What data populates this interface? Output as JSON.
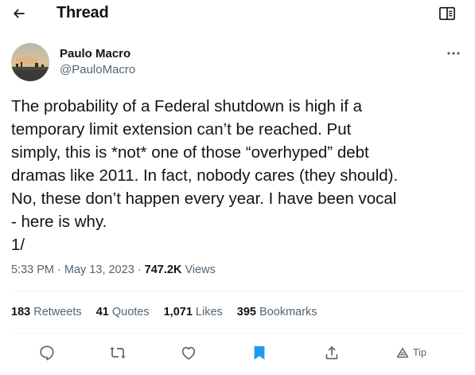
{
  "header": {
    "title": "Thread",
    "back_icon": "arrow-left-icon",
    "reader_icon": "open-book-icon"
  },
  "author": {
    "name": "Paulo Macro",
    "handle": "@PauloMacro",
    "avatar": "sunset-cityscape-photo"
  },
  "tweet": {
    "lines": [
      "The probability of a Federal shutdown is high if a",
      "temporary limit extension can’t be reached. Put",
      "simply, this is *not* one of those “overhyped” debt",
      "dramas like 2011. In fact, nobody cares (they should).",
      "No, these don’t happen every year. I have been vocal",
      "- here is why.",
      "1/"
    ]
  },
  "meta": {
    "time": "5:33 PM",
    "separator": " · ",
    "date": "May 13, 2023",
    "views_count": "747.2K",
    "views_label": " Views"
  },
  "stats": {
    "retweets": {
      "count": "183",
      "label": " Retweets"
    },
    "quotes": {
      "count": "41",
      "label": " Quotes"
    },
    "likes": {
      "count": "1,071",
      "label": " Likes"
    },
    "bookmarks": {
      "count": "395",
      "label": " Bookmarks"
    }
  },
  "actions": {
    "reply_icon": "speech-bubble-icon",
    "retweet_icon": "retweet-arrows-icon",
    "like_icon": "heart-icon",
    "bookmark_icon": "bookmark-filled-icon",
    "share_icon": "share-upload-icon",
    "tip_icon": "tip-triangle-icon",
    "tip_label": "Tip"
  },
  "colors": {
    "text": "#0f1419",
    "secondary": "#536471",
    "accent": "#1d9bf0",
    "divider": "#eff3f4"
  }
}
